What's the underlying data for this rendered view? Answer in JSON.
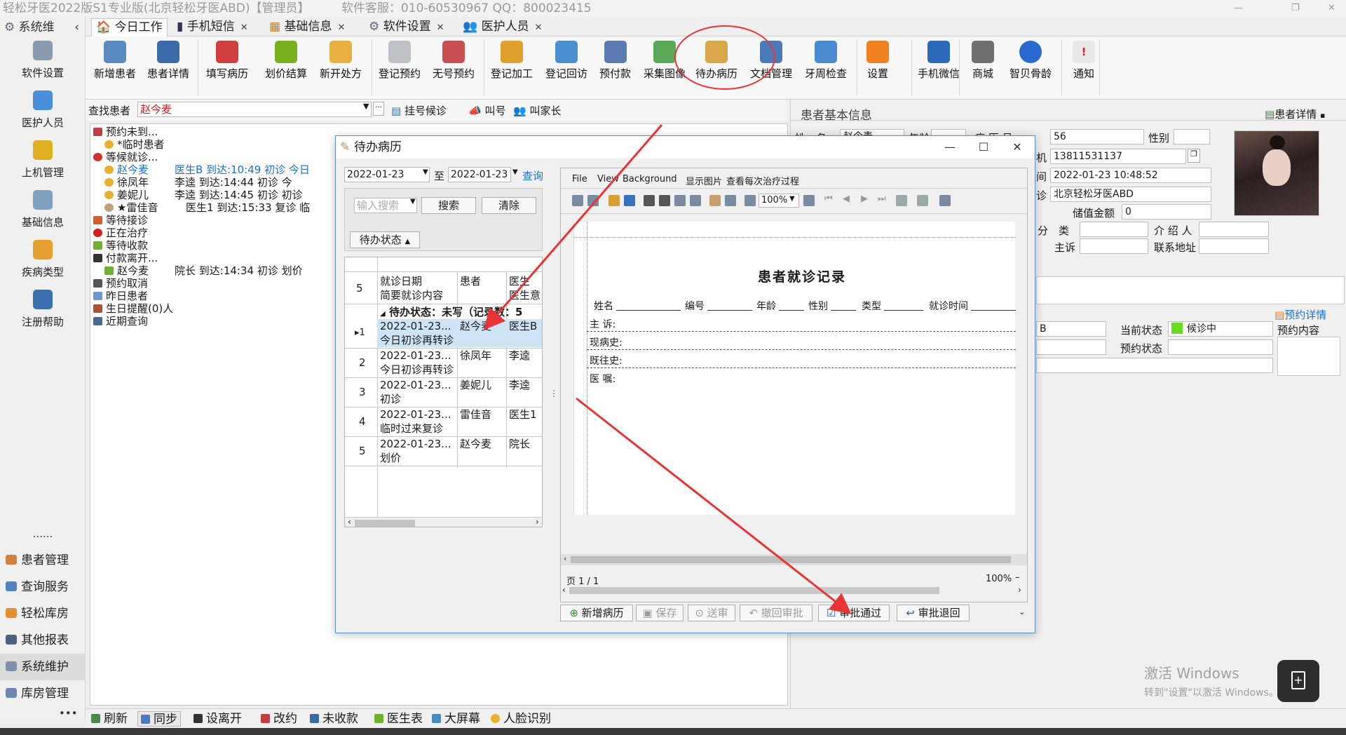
{
  "window": {
    "title": "轻松牙医2022版S1专业版(北京轻松牙医ABD)【管理员】",
    "support": "软件客服：010-60530967 QQ：800023415"
  },
  "leftnav": {
    "header": "系统维",
    "top_items": [
      "软件设置",
      "医护人员",
      "上机管理",
      "基础信息",
      "疾病类型",
      "注册帮助"
    ],
    "more": "......",
    "bottom_items": [
      "患者管理",
      "查询服务",
      "轻松库房",
      "其他报表",
      "系统维护",
      "库房管理"
    ],
    "overflow": "•••"
  },
  "tabs": [
    {
      "label": "今日工作"
    },
    {
      "label": "手机短信"
    },
    {
      "label": "基础信息"
    },
    {
      "label": "软件设置"
    },
    {
      "label": "医护人员"
    }
  ],
  "ribbon": {
    "buttons": [
      "新增患者",
      "患者详情",
      "填写病历",
      "划价结算",
      "新开处方",
      "登记预约",
      "无号预约",
      "登记加工",
      "登记回访",
      "预付款",
      "采集图像",
      "待办病历",
      "文档管理",
      "牙周检查",
      "设置",
      "手机微信",
      "商城",
      "智贝骨龄",
      "通知"
    ]
  },
  "search": {
    "label": "查找患者",
    "value": "赵今麦",
    "actions": [
      "挂号候诊",
      "叫号",
      "叫家长"
    ]
  },
  "tree": [
    {
      "text": "预约未到...",
      "col2": ""
    },
    {
      "text": "*临时患者",
      "col2": ""
    },
    {
      "text": "等候就诊...",
      "col2": ""
    },
    {
      "text": "赵今麦",
      "col2": "医生B  到达:10:49 初诊 今日"
    },
    {
      "text": "徐凤年",
      "col2": "李逵    到达:14:44 初诊 今"
    },
    {
      "text": "姜妮儿",
      "col2": "李逵    到达:14:45 初诊 初诊"
    },
    {
      "text": "★雷佳音",
      "col2": "医生1 到达:15:33 复诊 临"
    },
    {
      "text": "等待接诊",
      "col2": ""
    },
    {
      "text": "正在治疗",
      "col2": ""
    },
    {
      "text": "等待收款",
      "col2": ""
    },
    {
      "text": "付款离开...",
      "col2": ""
    },
    {
      "text": "赵今麦",
      "col2": "院长    到达:14:34 初诊 划价"
    },
    {
      "text": "预约取消",
      "col2": ""
    },
    {
      "text": "昨日患者",
      "col2": ""
    },
    {
      "text": "生日提醒(0)人",
      "col2": ""
    },
    {
      "text": "近期查询",
      "col2": ""
    }
  ],
  "bottombar": [
    "刷新",
    "同步",
    "设离开",
    "改约",
    "未收款",
    "医生表",
    "大屏幕",
    "人脸识别"
  ],
  "patient": {
    "section": "患者基本信息",
    "details_link": "患者详情",
    "labels": {
      "name": "姓　名",
      "age": "年龄",
      "record_no": "病 历 号",
      "gender": "性别",
      "phone": "机",
      "time": "间",
      "clinic": "诊",
      "balance": "储值金额",
      "category": "分　类",
      "referrer": "介 绍 人",
      "complaint": "主诉",
      "address": "联系地址",
      "current_status": "当前状态",
      "appt_status": "预约状态",
      "appt_content": "预约内容",
      "appt_details": "预约详情"
    },
    "values": {
      "name": "赵今麦",
      "record_no": "56",
      "phone": "13811531137",
      "time": "2022-01-23 10:48:52",
      "clinic": "北京轻松牙医ABD",
      "balance": "0",
      "doctor": "B",
      "current_status": "候诊中"
    }
  },
  "dialog": {
    "title": "待办病历",
    "date_from": "2022-01-23",
    "to_label": "至",
    "date_to": "2022-01-23",
    "query": "查询",
    "search_placeholder": "输入搜索",
    "search_btn": "搜索",
    "clear_btn": "清除",
    "group_by": "待办状态",
    "grid_headers": {
      "count": "5",
      "date": "就诊日期",
      "patient": "患者",
      "doctor": "医生",
      "brief": "简要就诊内容",
      "doctor_note": "医生意"
    },
    "group_row": "待办状态：未写（记录数：5",
    "rows": [
      {
        "idx": "1",
        "date": "2022-01-23...",
        "patient": "赵今麦",
        "doctor": "医生B",
        "content": "今日初诊再转诊"
      },
      {
        "idx": "2",
        "date": "2022-01-23...",
        "patient": "徐凤年",
        "doctor": "李逵",
        "content": "今日初诊再转诊"
      },
      {
        "idx": "3",
        "date": "2022-01-23...",
        "patient": "姜妮儿",
        "doctor": "李逵",
        "content": "初诊"
      },
      {
        "idx": "4",
        "date": "2022-01-23...",
        "patient": "雷佳音",
        "doctor": "医生1",
        "content": "临时过来复诊"
      },
      {
        "idx": "5",
        "date": "2022-01-23...",
        "patient": "赵今麦",
        "doctor": "院长",
        "content": "划价"
      }
    ],
    "preview_menu": [
      "File",
      "View",
      "Background",
      "显示图片",
      "查看每次治疗过程"
    ],
    "zoom": "100%",
    "form": {
      "title": "患者就诊记录",
      "fields": [
        "姓名",
        "编号",
        "年龄",
        "性别",
        "类型",
        "就诊时间"
      ],
      "lines": [
        "主 诉:",
        "现病史:",
        "既往史:",
        "医 嘱:"
      ]
    },
    "page": "页 1 / 1",
    "zoom_status": "100%",
    "buttons": [
      {
        "label": "新增病历",
        "enabled": true
      },
      {
        "label": "保存",
        "enabled": false
      },
      {
        "label": "送审",
        "enabled": false
      },
      {
        "label": "撤回审批",
        "enabled": false
      },
      {
        "label": "审批通过",
        "enabled": true
      },
      {
        "label": "审批退回",
        "enabled": true
      }
    ]
  },
  "watermark": {
    "line1": "激活 Windows",
    "line2": "转到\"设置\"以激活 Windows。"
  },
  "colors": {
    "accent": "#1e6fd0",
    "annotation": "#e83434",
    "status_green": "#66dd22"
  }
}
